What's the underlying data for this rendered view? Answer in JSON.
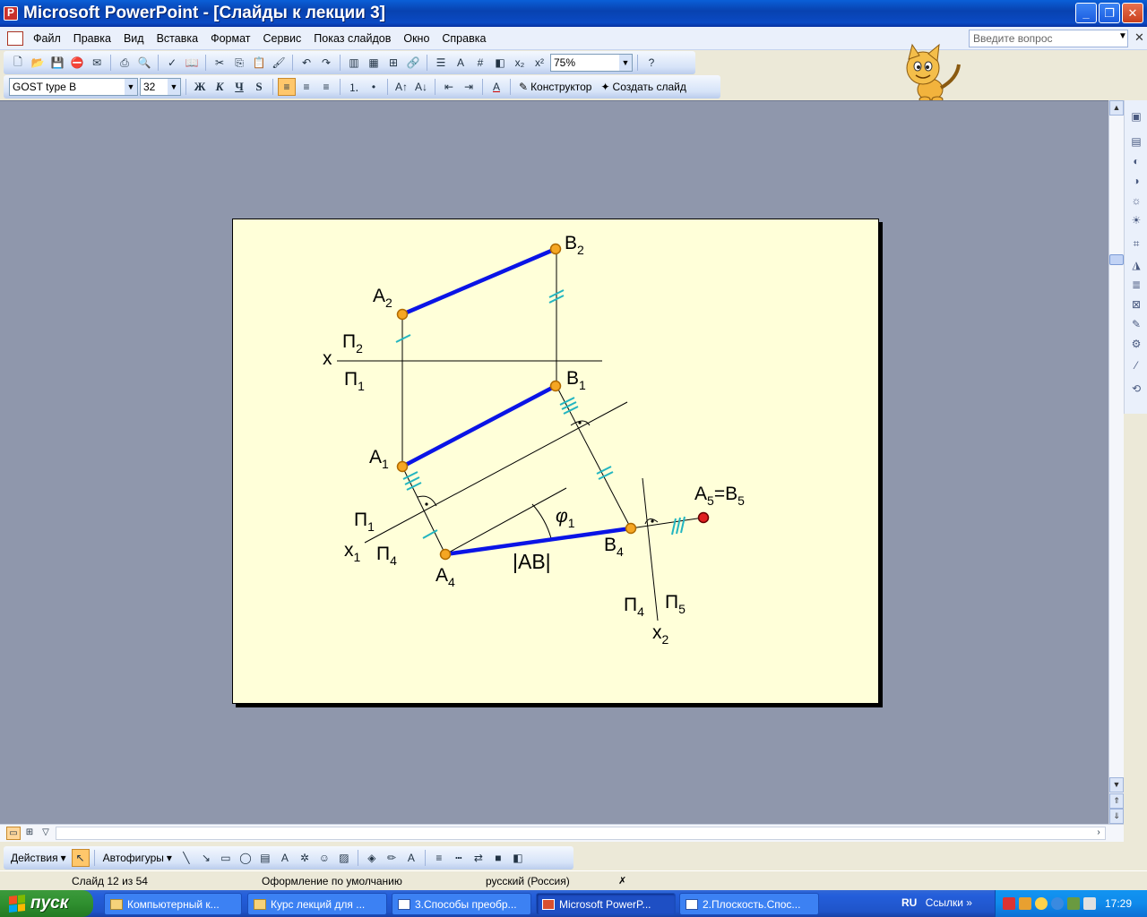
{
  "window": {
    "title": "Microsoft PowerPoint - [Слайды к лекции 3]",
    "buttons": {
      "minimize": "_",
      "maximize": "❐",
      "close": "✕"
    }
  },
  "menu": {
    "items": [
      "Файл",
      "Правка",
      "Вид",
      "Вставка",
      "Формат",
      "Сервис",
      "Показ слайдов",
      "Окно",
      "Справка"
    ],
    "help_placeholder": "Введите вопрос"
  },
  "toolbar": {
    "zoom": "75%",
    "font": "GOST type B",
    "size": "32",
    "bold": "Ж",
    "italic": "К",
    "underline": "Ч",
    "shadow": "S",
    "designer": "Конструктор",
    "new_slide": "Создать слайд"
  },
  "slide": {
    "labels": {
      "A2": "A",
      "A2_sub": "2",
      "B2": "B",
      "B2_sub": "2",
      "x": "x",
      "P2": "П",
      "P2_sub": "2",
      "P1": "П",
      "P1_sub": "1",
      "B1": "B",
      "B1_sub": "1",
      "A1": "A",
      "A1_sub": "1",
      "P1b": "П",
      "P1b_sub": "1",
      "x1": "x",
      "x1_sub": "1",
      "P4a": "П",
      "P4a_sub": "4",
      "A4": "A",
      "A4_sub": "4",
      "AB": "|AB|",
      "phi": "φ",
      "phi_sub": "1",
      "B4": "B",
      "B4_sub": "4",
      "A5": "A",
      "A5_sub": "5",
      "eq": "=B",
      "B5_sub": "5",
      "P4b": "П",
      "P4b_sub": "4",
      "P5": "П",
      "P5_sub": "5",
      "x2": "x",
      "x2_sub": "2"
    }
  },
  "drawing_toolbar": {
    "actions": "Действия",
    "autoshapes": "Автофигуры"
  },
  "status": {
    "slide": "Слайд 12 из 54",
    "design": "Оформление по умолчанию",
    "language": "русский (Россия)"
  },
  "taskbar": {
    "start": "пуск",
    "tasks": [
      "Компьютерный к...",
      "Курс лекций для ...",
      "3.Способы преобр...",
      "Microsoft PowerP...",
      "2.Плоскость.Спос..."
    ],
    "lang": "RU",
    "links": "Ссылки",
    "clock": "17:29"
  },
  "colors": {
    "slide_bg": "#FFFFD9",
    "segment": "#0A14E6",
    "tick_mark": "#22B5C0",
    "point_fill": "#F5A623",
    "point5_fill": "#E02020"
  }
}
